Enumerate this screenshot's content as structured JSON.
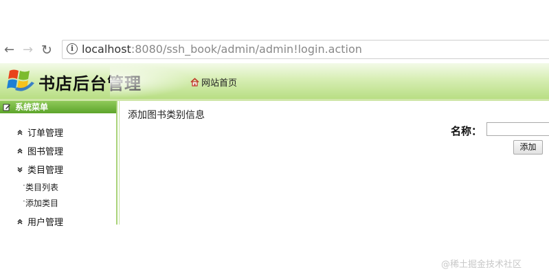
{
  "browser": {
    "url_host": "localhost",
    "url_rest": ":8080/ssh_book/admin/admin!login.action"
  },
  "header": {
    "title": "书店后台管理",
    "home_link": "网站首页"
  },
  "sidebar": {
    "title": "系统菜单",
    "items": [
      {
        "label": "订单管理",
        "state": "collapsed"
      },
      {
        "label": "图书管理",
        "state": "collapsed"
      },
      {
        "label": "类目管理",
        "state": "expanded",
        "children": [
          "类目列表",
          "添加类目"
        ]
      },
      {
        "label": "用户管理",
        "state": "collapsed"
      }
    ]
  },
  "main": {
    "heading": "添加图书类别信息",
    "name_label": "名称：",
    "name_value": "",
    "add_button": "添加"
  },
  "watermark": "@稀土掘金技术社区"
}
